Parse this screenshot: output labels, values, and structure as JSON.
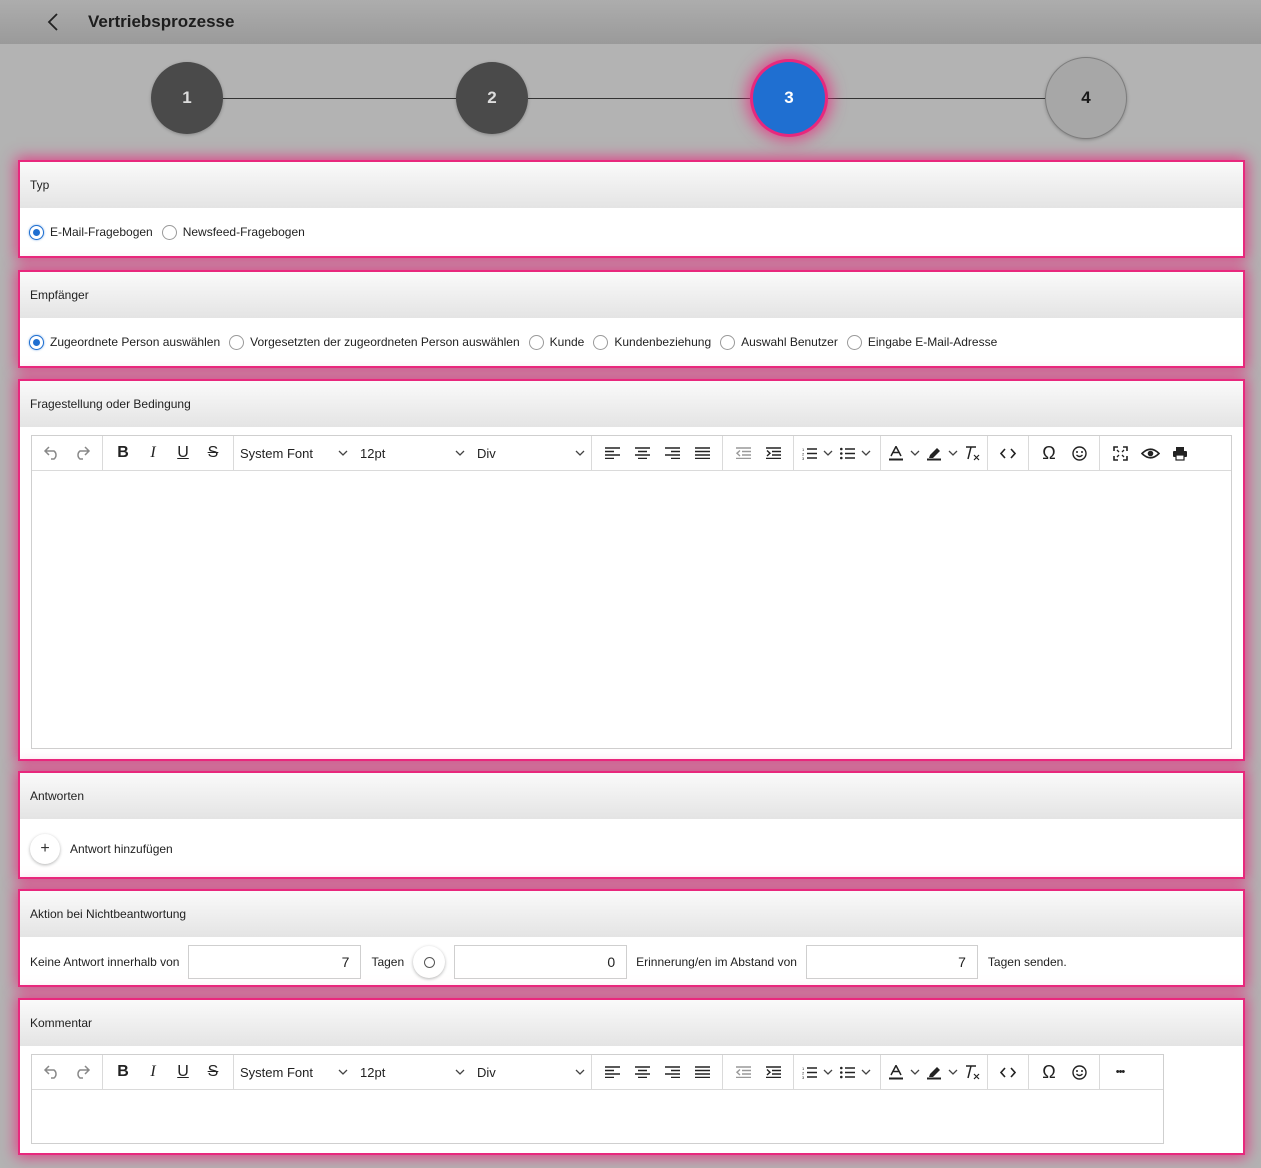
{
  "header": {
    "title": "Vertriebsprozesse"
  },
  "stepper": {
    "steps": [
      "1",
      "2",
      "3",
      "4"
    ],
    "active_step": 3
  },
  "typ": {
    "heading": "Typ",
    "options": [
      "E-Mail-Fragebogen",
      "Newsfeed-Fragebogen"
    ],
    "selected": "E-Mail-Fragebogen"
  },
  "empfaenger": {
    "heading": "Empfänger",
    "options": [
      "Zugeordnete Person auswählen",
      "Vorgesetzten der zugeordneten Person auswählen",
      "Kunde",
      "Kundenbeziehung",
      "Auswahl Benutzer",
      "Eingabe E-Mail-Adresse"
    ],
    "selected": "Zugeordnete Person auswählen"
  },
  "frage": {
    "heading": "Fragestellung oder Bedingung",
    "toolbar": {
      "font": "System Font",
      "size": "12pt",
      "block": "Div"
    }
  },
  "antworten": {
    "heading": "Antworten",
    "add_label": "Antwort hinzufügen",
    "add_symbol": "+"
  },
  "aktion": {
    "heading": "Aktion bei Nichtbeantwortung",
    "label_prefix": "Keine Antwort innerhalb von",
    "days_value": "7",
    "label_days": "Tagen",
    "reminders_value": "0",
    "label_interval": "Erinnerung/en im Abstand von",
    "interval_value": "7",
    "label_suffix": "Tagen senden."
  },
  "kommentar": {
    "heading": "Kommentar",
    "toolbar": {
      "font": "System Font",
      "size": "12pt",
      "block": "Div",
      "more": "•••"
    }
  },
  "colors": {
    "accent": "#1f6fd1",
    "highlight": "#e8287d"
  }
}
